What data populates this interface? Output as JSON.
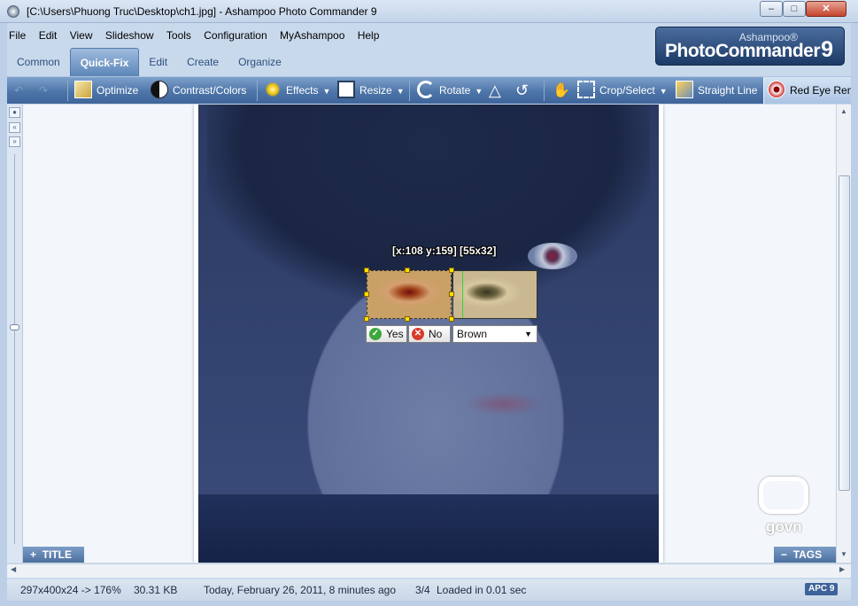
{
  "window": {
    "title": "[C:\\Users\\Phuong Truc\\Desktop\\ch1.jpg] - Ashampoo Photo Commander 9",
    "minimize": "–",
    "maximize": "□",
    "close": "✕"
  },
  "menu": [
    "File",
    "Edit",
    "View",
    "Slideshow",
    "Tools",
    "Configuration",
    "MyAshampoo",
    "Help"
  ],
  "tabs": [
    {
      "label": "Common",
      "active": false
    },
    {
      "label": "Quick-Fix",
      "active": true
    },
    {
      "label": "Edit",
      "active": false
    },
    {
      "label": "Create",
      "active": false
    },
    {
      "label": "Organize",
      "active": false
    }
  ],
  "logo": {
    "top": "Ashampoo®",
    "main": "PhotoCommander",
    "version": "9"
  },
  "toolbar": {
    "optimize": "Optimize",
    "contrast": "Contrast/Colors",
    "effects": "Effects",
    "resize": "Resize",
    "rotate": "Rotate",
    "crop": "Crop/Select",
    "straight": "Straight Line",
    "redeye": "Red Eye Remo"
  },
  "overlay": {
    "coords": "[x:108 y:159] [55x32]",
    "yes": "Yes",
    "no": "No",
    "eye_color": "Brown"
  },
  "panels": {
    "title": "TITLE",
    "tags": "TAGS"
  },
  "watermark": "govn",
  "status": {
    "dimensions": "297x400x24 -> 176%",
    "filesize": "30.31 KB",
    "date": "Today, February 26, 2011, 8 minutes ago",
    "position": "3/4",
    "loaded": "Loaded in 0.01 sec",
    "badge": "APC 9"
  }
}
